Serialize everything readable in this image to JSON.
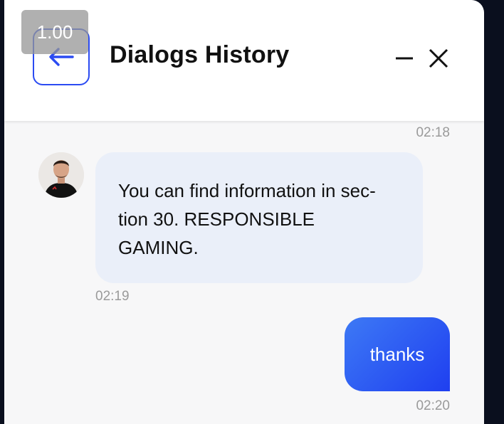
{
  "zoom": {
    "level": "1.00"
  },
  "header": {
    "title": "Dialogs History",
    "back_icon": "arrow-left-icon",
    "minimize_icon": "minus-icon",
    "close_icon": "close-icon",
    "accent_color": "#2b4bf2"
  },
  "messages": [
    {
      "time": "02:18"
    },
    {
      "sender": "agent",
      "text": "You can find information in sec-\ntion 30. RESPONSIBLE\nGAMING.",
      "time": "02:19"
    },
    {
      "sender": "user",
      "text": "thanks",
      "time": "02:20"
    }
  ]
}
